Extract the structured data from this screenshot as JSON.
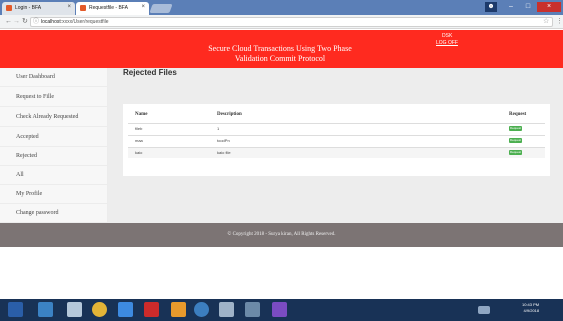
{
  "browser": {
    "tabs": [
      {
        "label": "Login - BFA"
      },
      {
        "label": "Requestfile - BFA"
      }
    ],
    "url": "localhost:xxxx/User/requestfile",
    "url_host": "localhost",
    "url_path": ":xxxx/User/requestfile"
  },
  "header": {
    "title_line1": "Secure Cloud Transactions Using Two Phase",
    "title_line2": "Validation Commit Protocol",
    "user": "DSK",
    "logout": "LOG OFF",
    "color": "#ff2a1f"
  },
  "sidebar": {
    "items": [
      {
        "label": "User Dashboard"
      },
      {
        "label": "Request to Fille"
      },
      {
        "label": "Check Already Requested"
      },
      {
        "label": "Accepted"
      },
      {
        "label": "Rejected"
      },
      {
        "label": "All"
      },
      {
        "label": "My Profile"
      },
      {
        "label": "Change password"
      }
    ]
  },
  "main": {
    "title": "Rejected Files",
    "columns": [
      "Name",
      "Description",
      "Request"
    ],
    "rows": [
      {
        "name": "fileb",
        "description": "1",
        "action": "Request"
      },
      {
        "name": "maa",
        "description": "toodPn",
        "action": "Request"
      },
      {
        "name": "kaio",
        "description": "kaio file",
        "action": "Request"
      }
    ],
    "button_color": "#4caf50"
  },
  "footer": {
    "text": "© Copyright 2018 - Surya kiran, All Rights Reserved."
  },
  "taskbar": {
    "time": "10:43 PM",
    "date": "4/9/2018"
  }
}
